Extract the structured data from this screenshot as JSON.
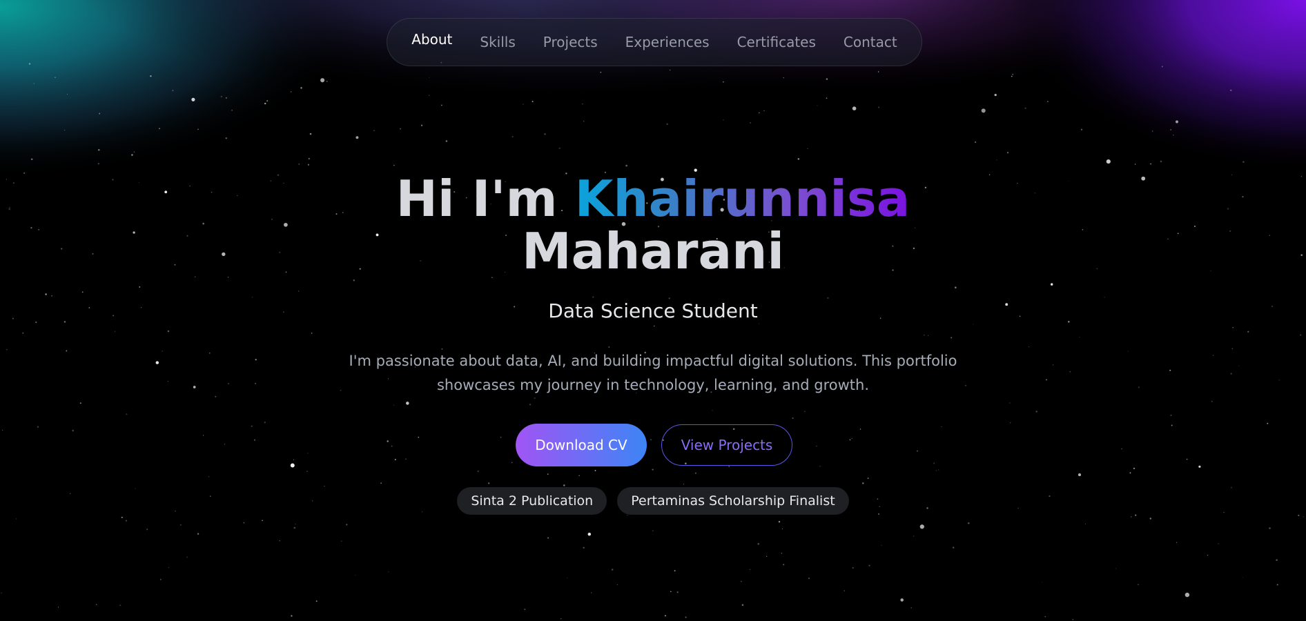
{
  "nav": {
    "items": [
      {
        "label": "About",
        "active": true
      },
      {
        "label": "Skills",
        "active": false
      },
      {
        "label": "Projects",
        "active": false
      },
      {
        "label": "Experiences",
        "active": false
      },
      {
        "label": "Certificates",
        "active": false
      },
      {
        "label": "Contact",
        "active": false
      }
    ]
  },
  "hero": {
    "greeting": "Hi I'm",
    "first_name": "Khairunnisa",
    "last_name": "Maharani",
    "subtitle": "Data Science Student",
    "description": "I'm passionate about data, AI, and building impactful digital solutions. This portfolio showcases my journey in technology, learning, and growth."
  },
  "buttons": {
    "download_cv": "Download CV",
    "view_projects": "View Projects"
  },
  "badges": [
    "Sinta 2 Publication",
    "Pertaminas Scholarship Finalist"
  ],
  "colors": {
    "background": "#000000",
    "aurora_teal": "#0a9e9a",
    "aurora_purple": "#6a10d8",
    "gradient_start": "#a155f4",
    "gradient_end": "#3d85f6",
    "outline_button": "#5a56e8"
  }
}
